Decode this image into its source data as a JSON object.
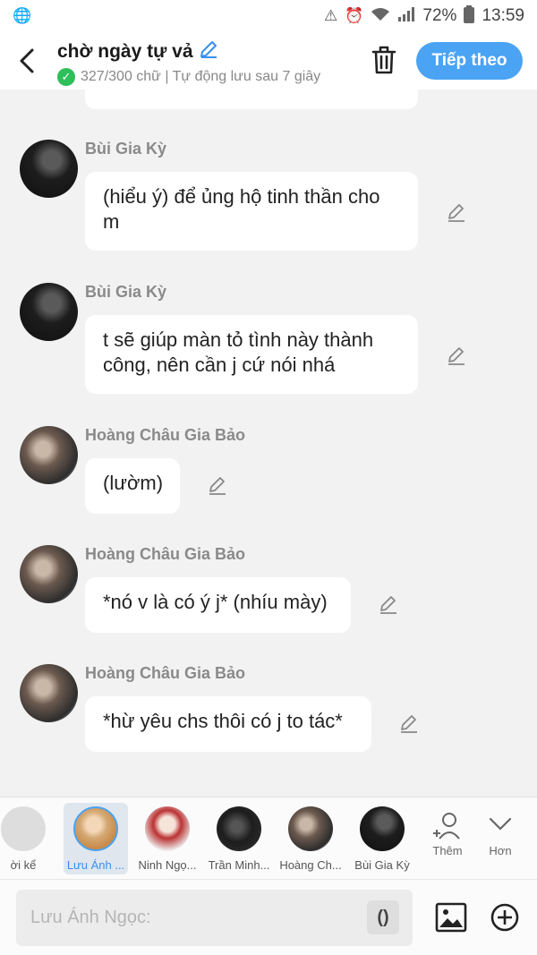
{
  "status_bar": {
    "battery": "72%",
    "time": "13:59"
  },
  "header": {
    "title": "chờ ngày tự vả",
    "subtitle": "327/300 chữ | Tự động lưu sau 7 giây",
    "next_button": "Tiếp theo"
  },
  "messages": [
    {
      "name": "Bùi Gia Kỳ",
      "text": "(hiểu ý) để ủng hộ tinh thần cho m"
    },
    {
      "name": "Bùi Gia Kỳ",
      "text": "t sẽ giúp màn tỏ tình này thành công, nên cần j cứ nói nhá"
    },
    {
      "name": "Hoàng Châu Gia Bảo",
      "text": "(lườm)"
    },
    {
      "name": "Hoàng Châu Gia Bảo",
      "text": "*nó v là có ý j* (nhíu mày)"
    },
    {
      "name": "Hoàng Châu Gia Bảo",
      "text": "*hừ yêu chs thôi có j to tác*"
    }
  ],
  "characters": [
    {
      "label": "ời kể"
    },
    {
      "label": "Lưu Ánh ..."
    },
    {
      "label": "Ninh Ngọ..."
    },
    {
      "label": "Trần Minh..."
    },
    {
      "label": "Hoàng Ch..."
    },
    {
      "label": "Bùi Gia Kỳ"
    }
  ],
  "tools": {
    "add_label": "Thêm",
    "more_label": "Hơn"
  },
  "input": {
    "placeholder": "Lưu Ánh Ngọc:",
    "paren_label": "()"
  }
}
